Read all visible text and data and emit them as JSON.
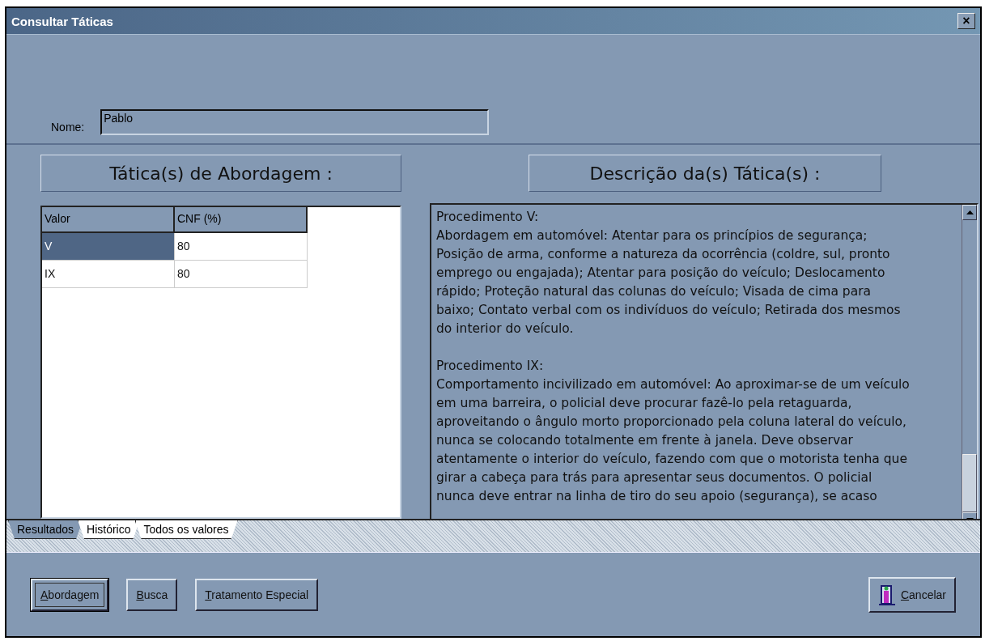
{
  "window": {
    "title": "Consultar Táticas",
    "close_label": "×"
  },
  "name_field": {
    "label": "Nome:",
    "value": "Pablo"
  },
  "left_header": "Tática(s) de Abordagem :",
  "right_header": "Descrição da(s) Tática(s) :",
  "table": {
    "columns": [
      "Valor",
      "CNF (%)"
    ],
    "rows": [
      {
        "cells": [
          "V",
          "80"
        ],
        "selected": true
      },
      {
        "cells": [
          "IX",
          "80"
        ],
        "selected": false
      }
    ]
  },
  "description": [
    {
      "lines": [
        "Procedimento V:",
        "Abordagem em automóvel: Atentar para os princípios de segurança;",
        "Posição de arma, conforme a natureza da ocorrência (coldre, sul, pronto",
        "emprego ou engajada); Atentar para posição do veículo; Deslocamento",
        "rápido; Proteção natural das colunas do veículo; Visada de cima para",
        "baixo; Contato verbal com os indivíduos do veículo; Retirada dos mesmos",
        "do interior do veículo."
      ]
    },
    {
      "lines": [
        "Procedimento IX:",
        "Comportamento incivilizado em automóvel: Ao aproximar-se de um veículo",
        "em uma barreira, o policial deve procurar fazê-lo pela retaguarda,",
        "aproveitando o ângulo morto proporcionado pela coluna lateral do veículo,",
        "nunca se colocando totalmente em frente à janela. Deve observar",
        "atentamente o interior do veículo, fazendo com que o motorista tenha que",
        "girar a cabeça para trás para apresentar seus documentos. O policial",
        "nunca deve entrar na linha de tiro do seu apoio (segurança), se acaso"
      ]
    }
  ],
  "tabs": [
    {
      "label": "Resultados",
      "selected": true
    },
    {
      "label": "Histórico",
      "selected": false
    },
    {
      "label": "Todos os valores",
      "selected": false
    }
  ],
  "buttons": [
    {
      "label": "Abordagem",
      "focused": true,
      "underline_first": true,
      "kind": "plain"
    },
    {
      "label": "Busca",
      "focused": false,
      "underline_first": true,
      "kind": "plain"
    },
    {
      "label": "Tratamento Especial",
      "focused": false,
      "underline_first": true,
      "kind": "plain"
    },
    {
      "label": "Cancelar",
      "focused": false,
      "underline_first": true,
      "kind": "exit"
    }
  ]
}
